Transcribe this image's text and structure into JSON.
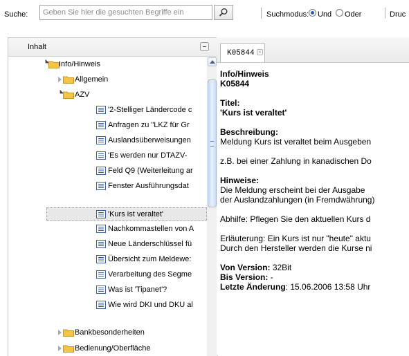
{
  "toolbar": {
    "search_label": "Suche:",
    "search_placeholder": "Geben Sie hier die gesuchten Begriffe ein",
    "mode_label": "Suchmodus:",
    "mode_options": [
      "Und",
      "Oder"
    ],
    "mode_selected": "Und",
    "print_label": "Druc"
  },
  "left_panel": {
    "title": "Inhalt",
    "tree": [
      {
        "label": "Info/Hinweis",
        "type": "folder",
        "expanded": true
      },
      {
        "label": "Allgemein",
        "type": "folder",
        "expanded": false
      },
      {
        "label": "AZV",
        "type": "folder",
        "expanded": true
      },
      {
        "label": "'2-Stelliger Ländercode c",
        "type": "doc"
      },
      {
        "label": "Anfragen zu \"LKZ für Gr",
        "type": "doc"
      },
      {
        "label": "Auslandsüberweisungen",
        "type": "doc"
      },
      {
        "label": "'Es werden nur DTAZV-",
        "type": "doc"
      },
      {
        "label": "Feld Q9 (Weiterleitung ar",
        "type": "doc"
      },
      {
        "label": "Fenster Ausführungsdat",
        "type": "doc"
      },
      {
        "label": "'Kurs ist veraltet'",
        "type": "doc",
        "selected": true
      },
      {
        "label": "Nachkommastellen von A",
        "type": "doc"
      },
      {
        "label": "Neue Länderschlüssel fü",
        "type": "doc"
      },
      {
        "label": "Übersicht zum Meldewe:",
        "type": "doc"
      },
      {
        "label": "Verarbeitung des Segme",
        "type": "doc"
      },
      {
        "label": "Was ist 'Tipanet'?",
        "type": "doc"
      },
      {
        "label": "Wie wird DKI und DKU al",
        "type": "doc"
      },
      {
        "label": "Bankbesonderheiten",
        "type": "folder",
        "expanded": false
      },
      {
        "label": "Bedienung/Oberfläche",
        "type": "folder",
        "expanded": false
      }
    ]
  },
  "tab": {
    "label": "K05844"
  },
  "article": {
    "category": "Info/Hinweis",
    "id": "K05844",
    "title_label": "Titel:",
    "title": "'Kurs ist veraltet'",
    "description_label": "Beschreibung:",
    "description_lines": [
      "Meldung Kurs ist veraltet beim Ausgeben",
      "z.B. bei einer Zahlung in kanadischen Do"
    ],
    "notes_label": "Hinweise:",
    "notes_lines": [
      "Die Meldung erscheint bei der Ausgabe",
      "der Auslandzahlungen (in Fremdwährung)"
    ],
    "remedy_line": "Abhilfe: Pflegen Sie den aktuellen Kurs d",
    "explanation_lines": [
      "Erläuterung: Ein Kurs ist nur \"heute\" aktu",
      "Durch den Hersteller werden die Kurse ni"
    ],
    "from_version_label": "Von Version:",
    "from_version": "32Bit",
    "to_version_label": "Bis Version:",
    "to_version": "-",
    "last_change_label": "Letzte Änderung",
    "last_change": ": 15.06.2006 13:58 Uhr"
  },
  "colors": {
    "folder": "#f2c545",
    "doc_icon": "#3a5f9e",
    "selection": "#e8e8e8",
    "scroll_thumb": "#c9d9f0"
  }
}
